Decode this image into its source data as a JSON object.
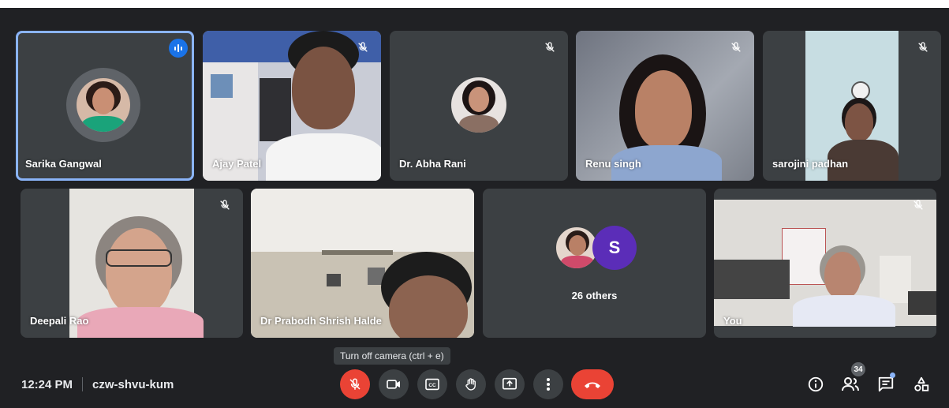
{
  "meeting": {
    "time": "12:24 PM",
    "code": "czw-shvu-kum"
  },
  "participants": [
    {
      "name": "Sarika Gangwal",
      "state": "speaking"
    },
    {
      "name": "Ajay Patel",
      "state": "muted"
    },
    {
      "name": "Dr. Abha Rani",
      "state": "muted"
    },
    {
      "name": "Renu singh",
      "state": "muted"
    },
    {
      "name": "sarojini padhan",
      "state": "muted"
    },
    {
      "name": "Deepali Rao",
      "state": "muted"
    },
    {
      "name": "Dr Prabodh Shrish Halde",
      "state": "muted"
    },
    {
      "name": "You",
      "state": "muted"
    }
  ],
  "others_tile": {
    "label": "26 others",
    "avatar_letter": "S"
  },
  "tooltip": "Turn off camera (ctrl + e)",
  "people_count": "34",
  "colors": {
    "background": "#202124",
    "tile": "#3c4043",
    "active_outline": "#8ab4f8",
    "speaking_badge": "#1a73e8",
    "danger": "#ea4335",
    "others_avatar": "#5b2db8"
  },
  "icons": {
    "mic": "mic-off-icon",
    "camera": "camera-icon",
    "captions": "captions-icon",
    "hand": "raise-hand-icon",
    "present": "present-icon",
    "more": "more-vert-icon",
    "end": "end-call-icon",
    "info": "info-icon",
    "people": "people-icon",
    "chat": "chat-icon",
    "activities": "activities-icon"
  }
}
